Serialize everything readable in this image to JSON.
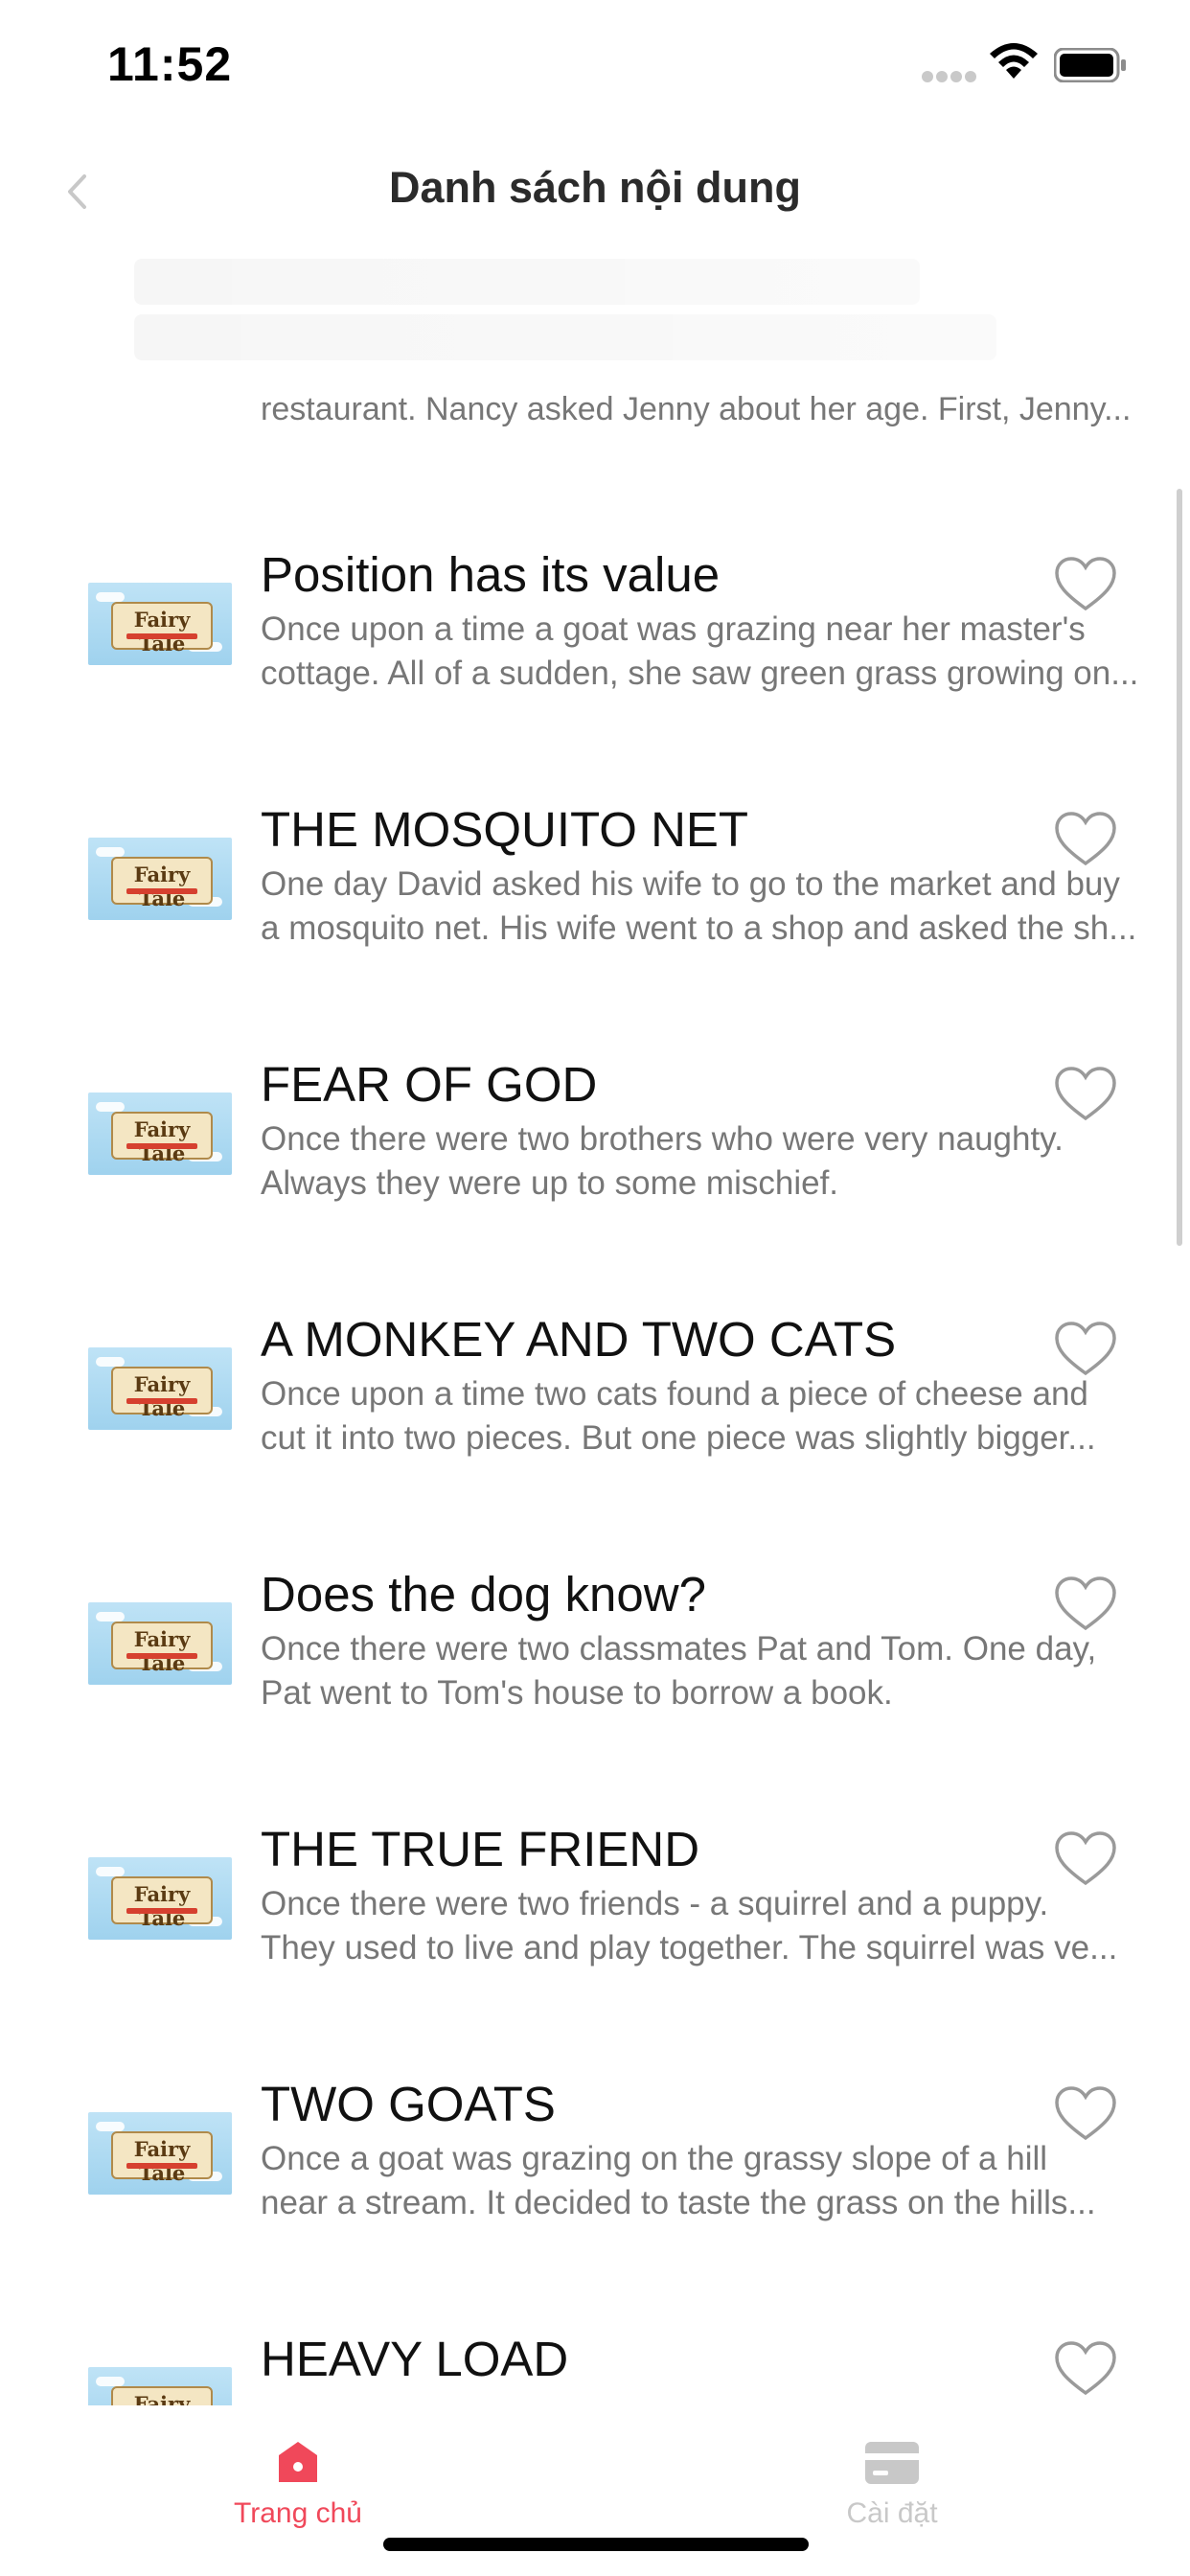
{
  "status_bar": {
    "time": "11:52"
  },
  "nav": {
    "title": "Danh sách nội dung"
  },
  "partial_row": {
    "description": "restaurant. Nancy asked Jenny about her age. First, Jenny..."
  },
  "thumbnail": {
    "title": "Fairy Tale"
  },
  "stories": [
    {
      "title": "Position has its value",
      "line1": "Once upon a time a goat was grazing near her master's",
      "line2": "cottage. All of a sudden, she saw green grass growing on..."
    },
    {
      "title": "THE MOSQUITO NET",
      "line1": "One day David asked his wife to go to the market and buy",
      "line2": "a mosquito net. His wife went to a shop and asked the sh..."
    },
    {
      "title": "FEAR OF GOD",
      "line1": "Once there were two brothers who were very naughty.",
      "line2": "Always they were up to some mischief."
    },
    {
      "title": "A MONKEY AND TWO CATS",
      "line1": "Once upon a time two cats found a piece of cheese and",
      "line2": "cut it into two pieces. But one piece was slightly bigger..."
    },
    {
      "title": "Does the dog know?",
      "line1": "Once there were two classmates Pat and Tom. One day,",
      "line2": "Pat went to Tom's house to borrow a book."
    },
    {
      "title": "THE TRUE FRIEND",
      "line1": "Once there were two friends - a squirrel and a puppy.",
      "line2": "They used to live and play together. The squirrel was ve..."
    },
    {
      "title": "TWO GOATS",
      "line1": "Once a goat was grazing on the grassy slope of a hill",
      "line2": "near a stream. It decided to taste the grass on the hills..."
    },
    {
      "title": "HEAVY LOAD",
      "line1": "",
      "line2": ""
    }
  ],
  "tabs": [
    {
      "label": "Trang chủ",
      "icon": "home-icon",
      "active": true
    },
    {
      "label": "Cài đặt",
      "icon": "card-icon",
      "active": false
    }
  ],
  "colors": {
    "accent": "#f0485a",
    "inactive": "#c8c8c8",
    "title": "#111111",
    "description": "#777777"
  }
}
